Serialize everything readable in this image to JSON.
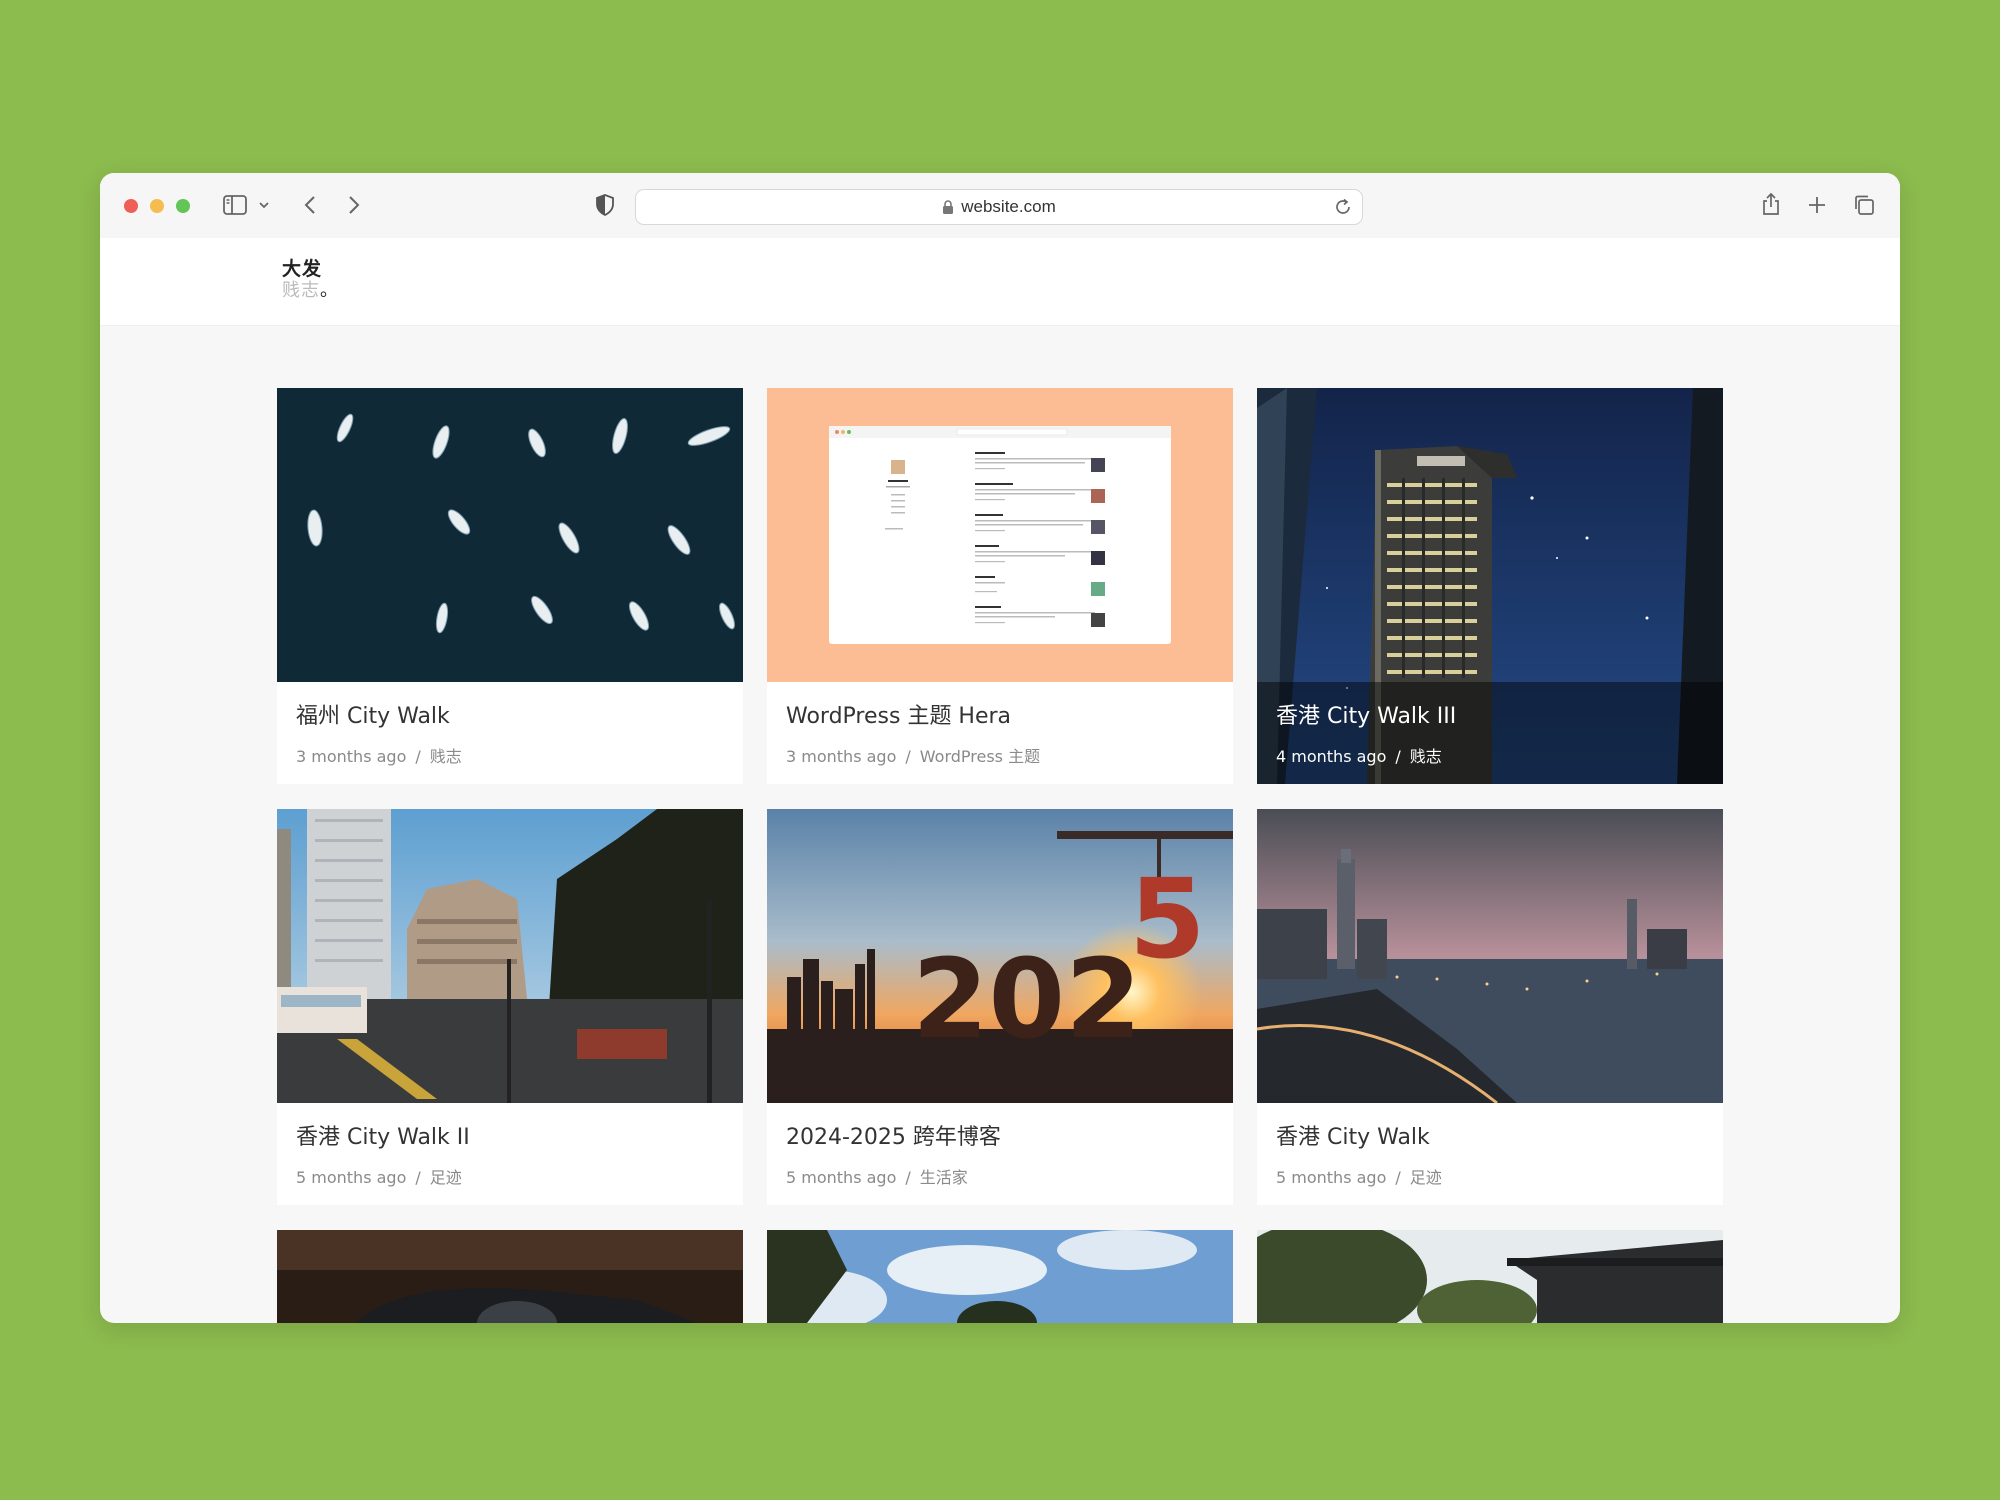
{
  "browser": {
    "url": "website.com",
    "colors": {
      "background": "#8cbb4e",
      "close": "#ee5f57",
      "minimize": "#f5bd4f",
      "zoom": "#62c555"
    }
  },
  "site": {
    "logo_line1": "大发",
    "logo_line2": "贱志",
    "logo_period": "。"
  },
  "posts": [
    {
      "title": "福州 City Walk",
      "time": "3 months ago",
      "sep": "/",
      "category": "贱志",
      "image": "boats-aerial-photo"
    },
    {
      "title": "WordPress 主题 Hera",
      "time": "3 months ago",
      "sep": "/",
      "category": "WordPress 主题",
      "image": "theme-screenshot"
    },
    {
      "title": "香港 City Walk III",
      "time": "4 months ago",
      "sep": "/",
      "category": "贱志",
      "image": "hotel-tower-night-photo"
    },
    {
      "title": "香港 City Walk II",
      "time": "5 months ago",
      "sep": "/",
      "category": "足迹",
      "image": "street-buildings-photo"
    },
    {
      "title": "2024-2025 跨年博客",
      "time": "5 months ago",
      "sep": "/",
      "category": "生活家",
      "image": "sunset-2025-photo",
      "image_text": [
        "202",
        "5"
      ]
    },
    {
      "title": "香港 City Walk",
      "time": "5 months ago",
      "sep": "/",
      "category": "足迹",
      "image": "harbour-dusk-photo"
    },
    {
      "image": "camera-photo"
    },
    {
      "image": "sky-trees-photo"
    },
    {
      "image": "building-trees-photo"
    }
  ]
}
